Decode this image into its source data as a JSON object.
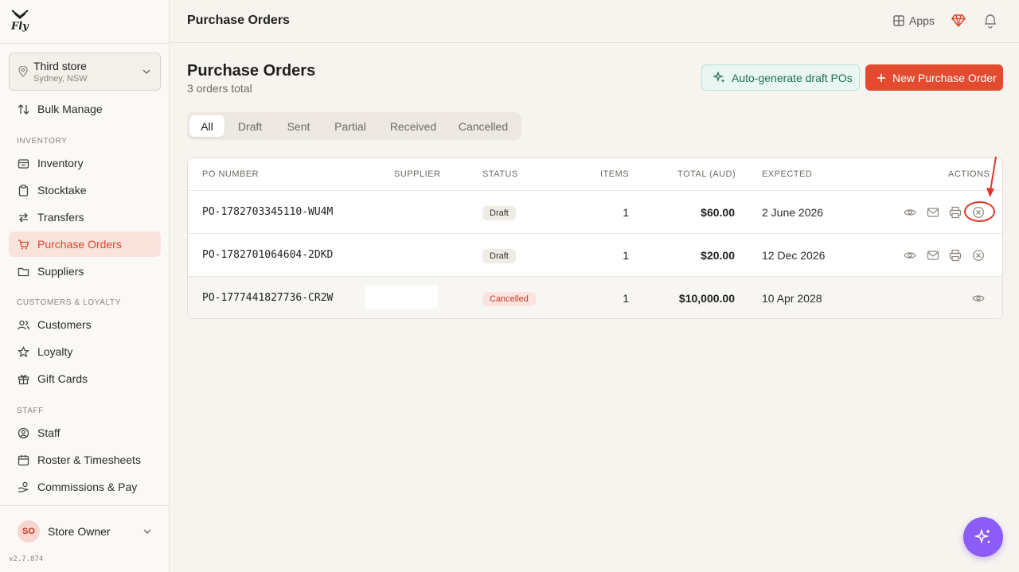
{
  "app": {
    "logo_text": "Fly"
  },
  "store": {
    "name": "Third store",
    "location": "Sydney, NSW"
  },
  "sidebar": {
    "top_items": [
      {
        "label": "Bulk Manage",
        "icon": "sort-arrows-icon"
      }
    ],
    "sections": [
      {
        "title": "INVENTORY",
        "items": [
          {
            "label": "Inventory",
            "icon": "box-icon"
          },
          {
            "label": "Stocktake",
            "icon": "clipboard-icon"
          },
          {
            "label": "Transfers",
            "icon": "arrows-icon"
          },
          {
            "label": "Purchase Orders",
            "icon": "cart-icon",
            "active": true
          },
          {
            "label": "Suppliers",
            "icon": "folder-icon"
          }
        ]
      },
      {
        "title": "CUSTOMERS & LOYALTY",
        "items": [
          {
            "label": "Customers",
            "icon": "users-icon"
          },
          {
            "label": "Loyalty",
            "icon": "star-icon"
          },
          {
            "label": "Gift Cards",
            "icon": "gift-icon"
          }
        ]
      },
      {
        "title": "STAFF",
        "items": [
          {
            "label": "Staff",
            "icon": "user-circle-icon"
          },
          {
            "label": "Roster & Timesheets",
            "icon": "calendar-icon"
          },
          {
            "label": "Commissions & Pay",
            "icon": "hand-coins-icon"
          }
        ]
      }
    ]
  },
  "user": {
    "initials": "SO",
    "name": "Store Owner"
  },
  "version": "v2.7.874",
  "header": {
    "title": "Purchase Orders",
    "apps_label": "Apps"
  },
  "page": {
    "title": "Purchase Orders",
    "subtitle": "3 orders total",
    "auto_button": "Auto-generate draft POs",
    "new_button": "New Purchase Order"
  },
  "tabs": [
    "All",
    "Draft",
    "Sent",
    "Partial",
    "Received",
    "Cancelled"
  ],
  "table": {
    "columns": [
      "PO NUMBER",
      "SUPPLIER",
      "STATUS",
      "ITEMS",
      "TOTAL (AUD)",
      "EXPECTED",
      "ACTIONS"
    ],
    "rows": [
      {
        "po": "PO-1782703345110-WU4M",
        "status": "Draft",
        "items": "1",
        "total": "$60.00",
        "expected": "2 June 2026"
      },
      {
        "po": "PO-1782701064604-2DKD",
        "status": "Draft",
        "items": "1",
        "total": "$20.00",
        "expected": "12 Dec 2026"
      },
      {
        "po": "PO-1777441827736-CR2W",
        "status": "Cancelled",
        "items": "1",
        "total": "$10,000.00",
        "expected": "10 Apr 2028"
      }
    ]
  },
  "colors": {
    "accent": "#e44a2f",
    "ai_fab": "#8b5cf6",
    "annotation": "#e0352b"
  }
}
